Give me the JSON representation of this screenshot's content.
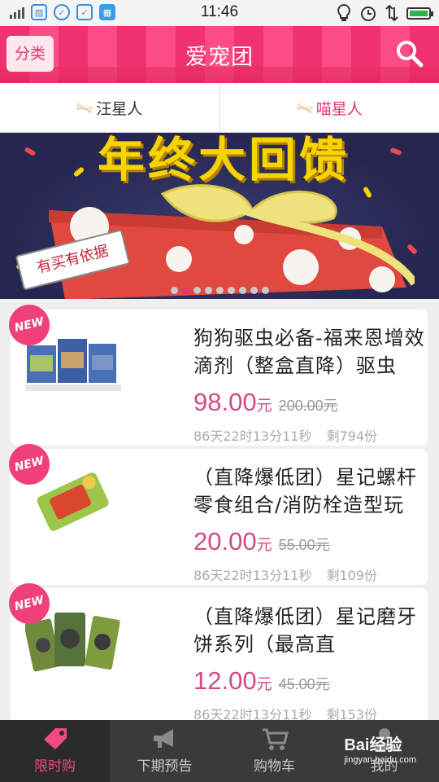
{
  "status_bar": {
    "time": "11:46",
    "icons": [
      "signal-icon",
      "gallery-icon",
      "check-icon",
      "shield-check-icon",
      "store-icon",
      "bulb-icon",
      "alarm-icon",
      "data-transfer-icon",
      "battery-icon"
    ],
    "battery_level": 1.0
  },
  "header": {
    "category_label": "分类",
    "title": "爱宠团",
    "search_icon": "search-icon",
    "bg_color": "#f0336f"
  },
  "tabs": [
    {
      "label": "汪星人",
      "icon": "bone-icon",
      "active": false
    },
    {
      "label": "喵星人",
      "icon": "bone-icon",
      "active": true
    }
  ],
  "banner": {
    "headline": "年终大回馈",
    "tag_text": "有买有依据",
    "slide_count": 9,
    "active_slide": 1
  },
  "products": [
    {
      "badge": "NEW",
      "title": "狗狗驱虫必备-福来恩增效滴剂（整盒直降）驱虫",
      "price": "98.00",
      "currency": "元",
      "original_price": "200.00",
      "countdown": "86天22时13分11秒",
      "stock": "剩794份"
    },
    {
      "badge": "NEW",
      "title": "（直降爆低团）星记螺杆零食组合/消防栓造型玩",
      "price": "20.00",
      "currency": "元",
      "original_price": "55.00",
      "countdown": "86天22时13分11秒",
      "stock": "剩109份"
    },
    {
      "badge": "NEW",
      "title": "（直降爆低团）星记磨牙饼系列（最高直",
      "price": "12.00",
      "currency": "元",
      "original_price": "45.00",
      "countdown": "86天22时13分11秒",
      "stock": "剩153份"
    }
  ],
  "bottom_nav": [
    {
      "label": "限时购",
      "icon": "price-tag-icon",
      "active": true
    },
    {
      "label": "下期预告",
      "icon": "megaphone-icon",
      "active": false
    },
    {
      "label": "购物车",
      "icon": "cart-icon",
      "active": false
    },
    {
      "label": "我的",
      "icon": "user-icon",
      "active": false
    }
  ],
  "watermark": {
    "brand": "Bai经验",
    "url": "jingyan.baidu.com"
  },
  "colors": {
    "accent": "#e8356f",
    "price": "#d44a86",
    "nav_bg": "#3a3a3a"
  }
}
